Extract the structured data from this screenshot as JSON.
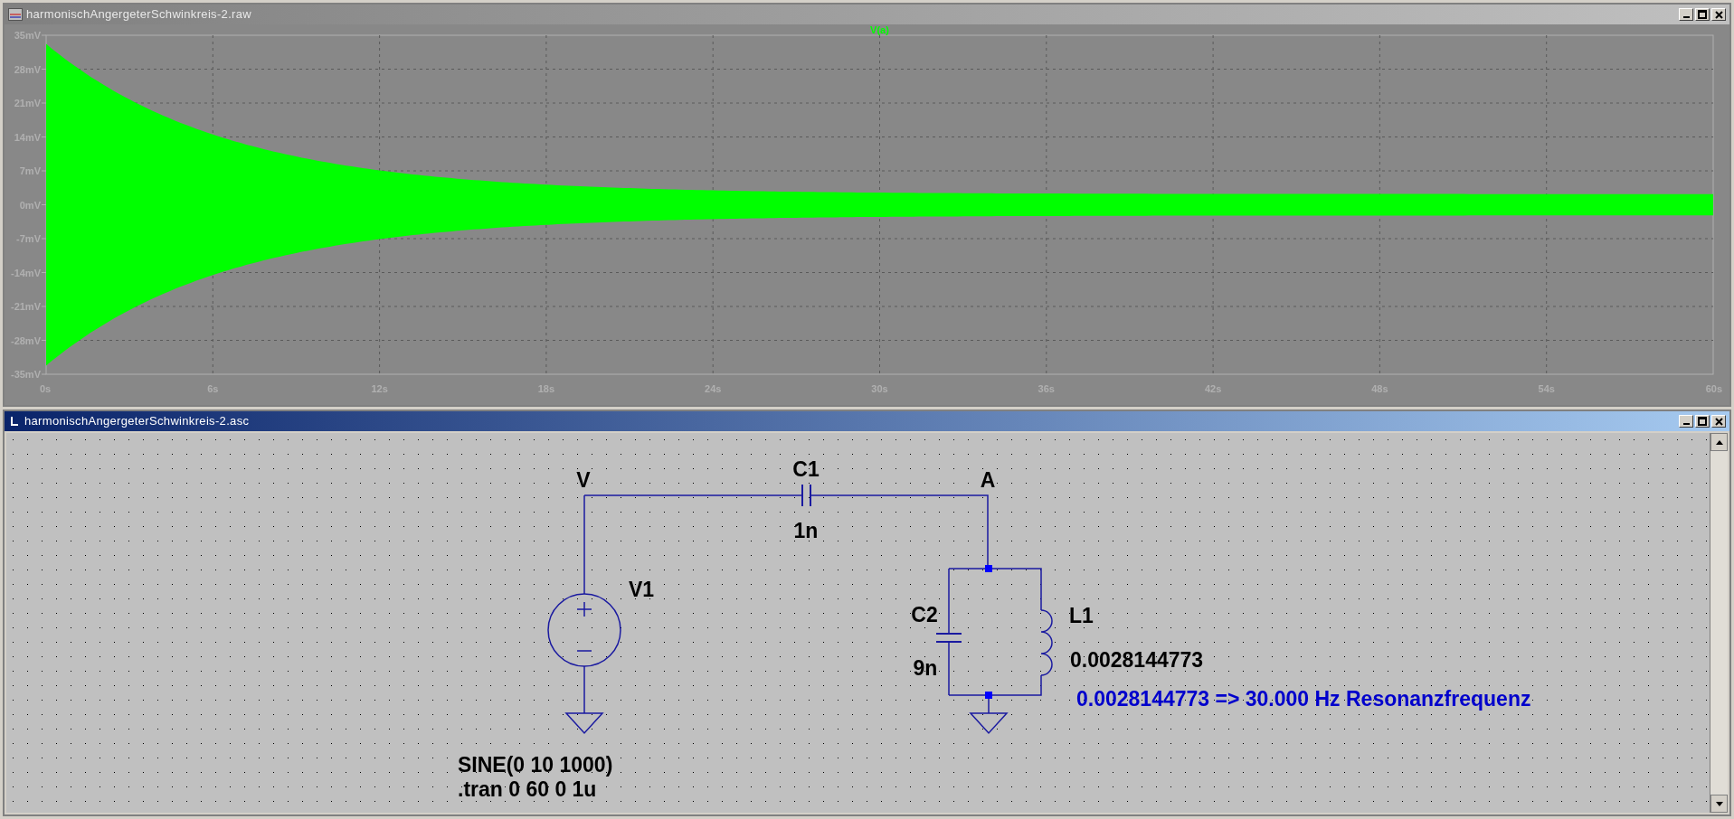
{
  "plot_window": {
    "title": "harmonischAngergeterSchwinkreis-2.raw",
    "trace_label": "V(a)",
    "y_ticks": [
      "35mV",
      "28mV",
      "21mV",
      "14mV",
      "7mV",
      "0mV",
      "-7mV",
      "-14mV",
      "-21mV",
      "-28mV",
      "-35mV"
    ],
    "x_ticks": [
      "0s",
      "6s",
      "12s",
      "18s",
      "24s",
      "30s",
      "36s",
      "42s",
      "48s",
      "54s",
      "60s"
    ]
  },
  "schematic_window": {
    "title": "harmonischAngergeterSchwinkreis-2.asc",
    "labels": [
      {
        "kind": "net",
        "text": "V"
      },
      {
        "kind": "component",
        "text": "C1"
      },
      {
        "kind": "value",
        "text": "1n"
      },
      {
        "kind": "net",
        "text": "A"
      },
      {
        "kind": "component",
        "text": "V1"
      },
      {
        "kind": "component",
        "text": "C2"
      },
      {
        "kind": "value",
        "text": "9n"
      },
      {
        "kind": "component",
        "text": "L1"
      },
      {
        "kind": "value",
        "text": "0.0028144773"
      },
      {
        "kind": "comment",
        "text": "0.0028144773 => 30.000 Hz Resonanzfrequenz"
      },
      {
        "kind": "value",
        "text": "SINE(0 10 1000)"
      },
      {
        "kind": "directive",
        "text": ".tran 0 60 0 1u"
      }
    ]
  }
}
